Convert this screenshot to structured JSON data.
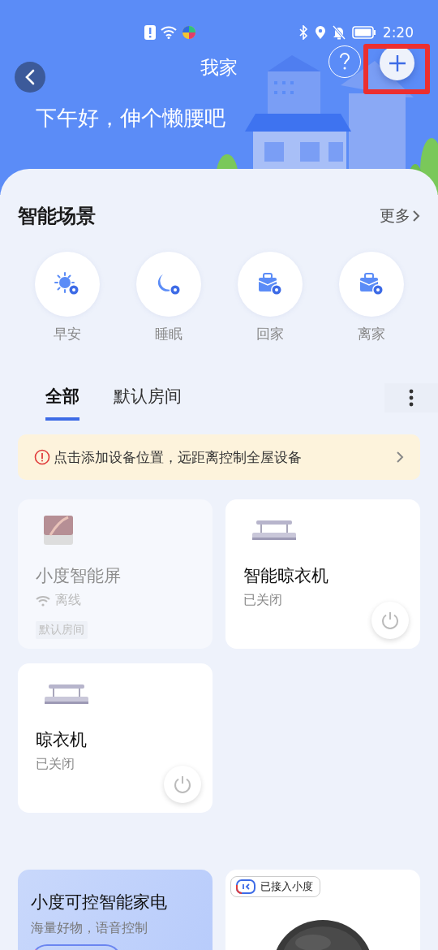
{
  "status_bar": {
    "time": "2:20"
  },
  "header": {
    "title": "我家",
    "greeting": "下午好，伸个懒腰吧"
  },
  "scenes": {
    "title": "智能场景",
    "more": "更多",
    "items": [
      {
        "label": "早安",
        "kind": "sun"
      },
      {
        "label": "睡眠",
        "kind": "moon"
      },
      {
        "label": "回家",
        "kind": "bag"
      },
      {
        "label": "离家",
        "kind": "bag"
      }
    ]
  },
  "tabs": [
    {
      "label": "全部",
      "selected": true
    },
    {
      "label": "默认房间",
      "selected": false
    }
  ],
  "notice": {
    "text": "点击添加设备位置，远距离控制全屋设备"
  },
  "devices": [
    {
      "name": "小度智能屏",
      "status": "离线",
      "online": false,
      "kind": "screen",
      "room": "默认房间"
    },
    {
      "name": "智能晾衣机",
      "status": "已关闭",
      "online": true,
      "kind": "rack"
    },
    {
      "name": "晾衣机",
      "status": "已关闭",
      "online": true,
      "kind": "rack"
    }
  ],
  "promo": {
    "title": "小度可控智能家电",
    "subtitle": "海量好物，语音控制",
    "badge": "已接入小度"
  }
}
